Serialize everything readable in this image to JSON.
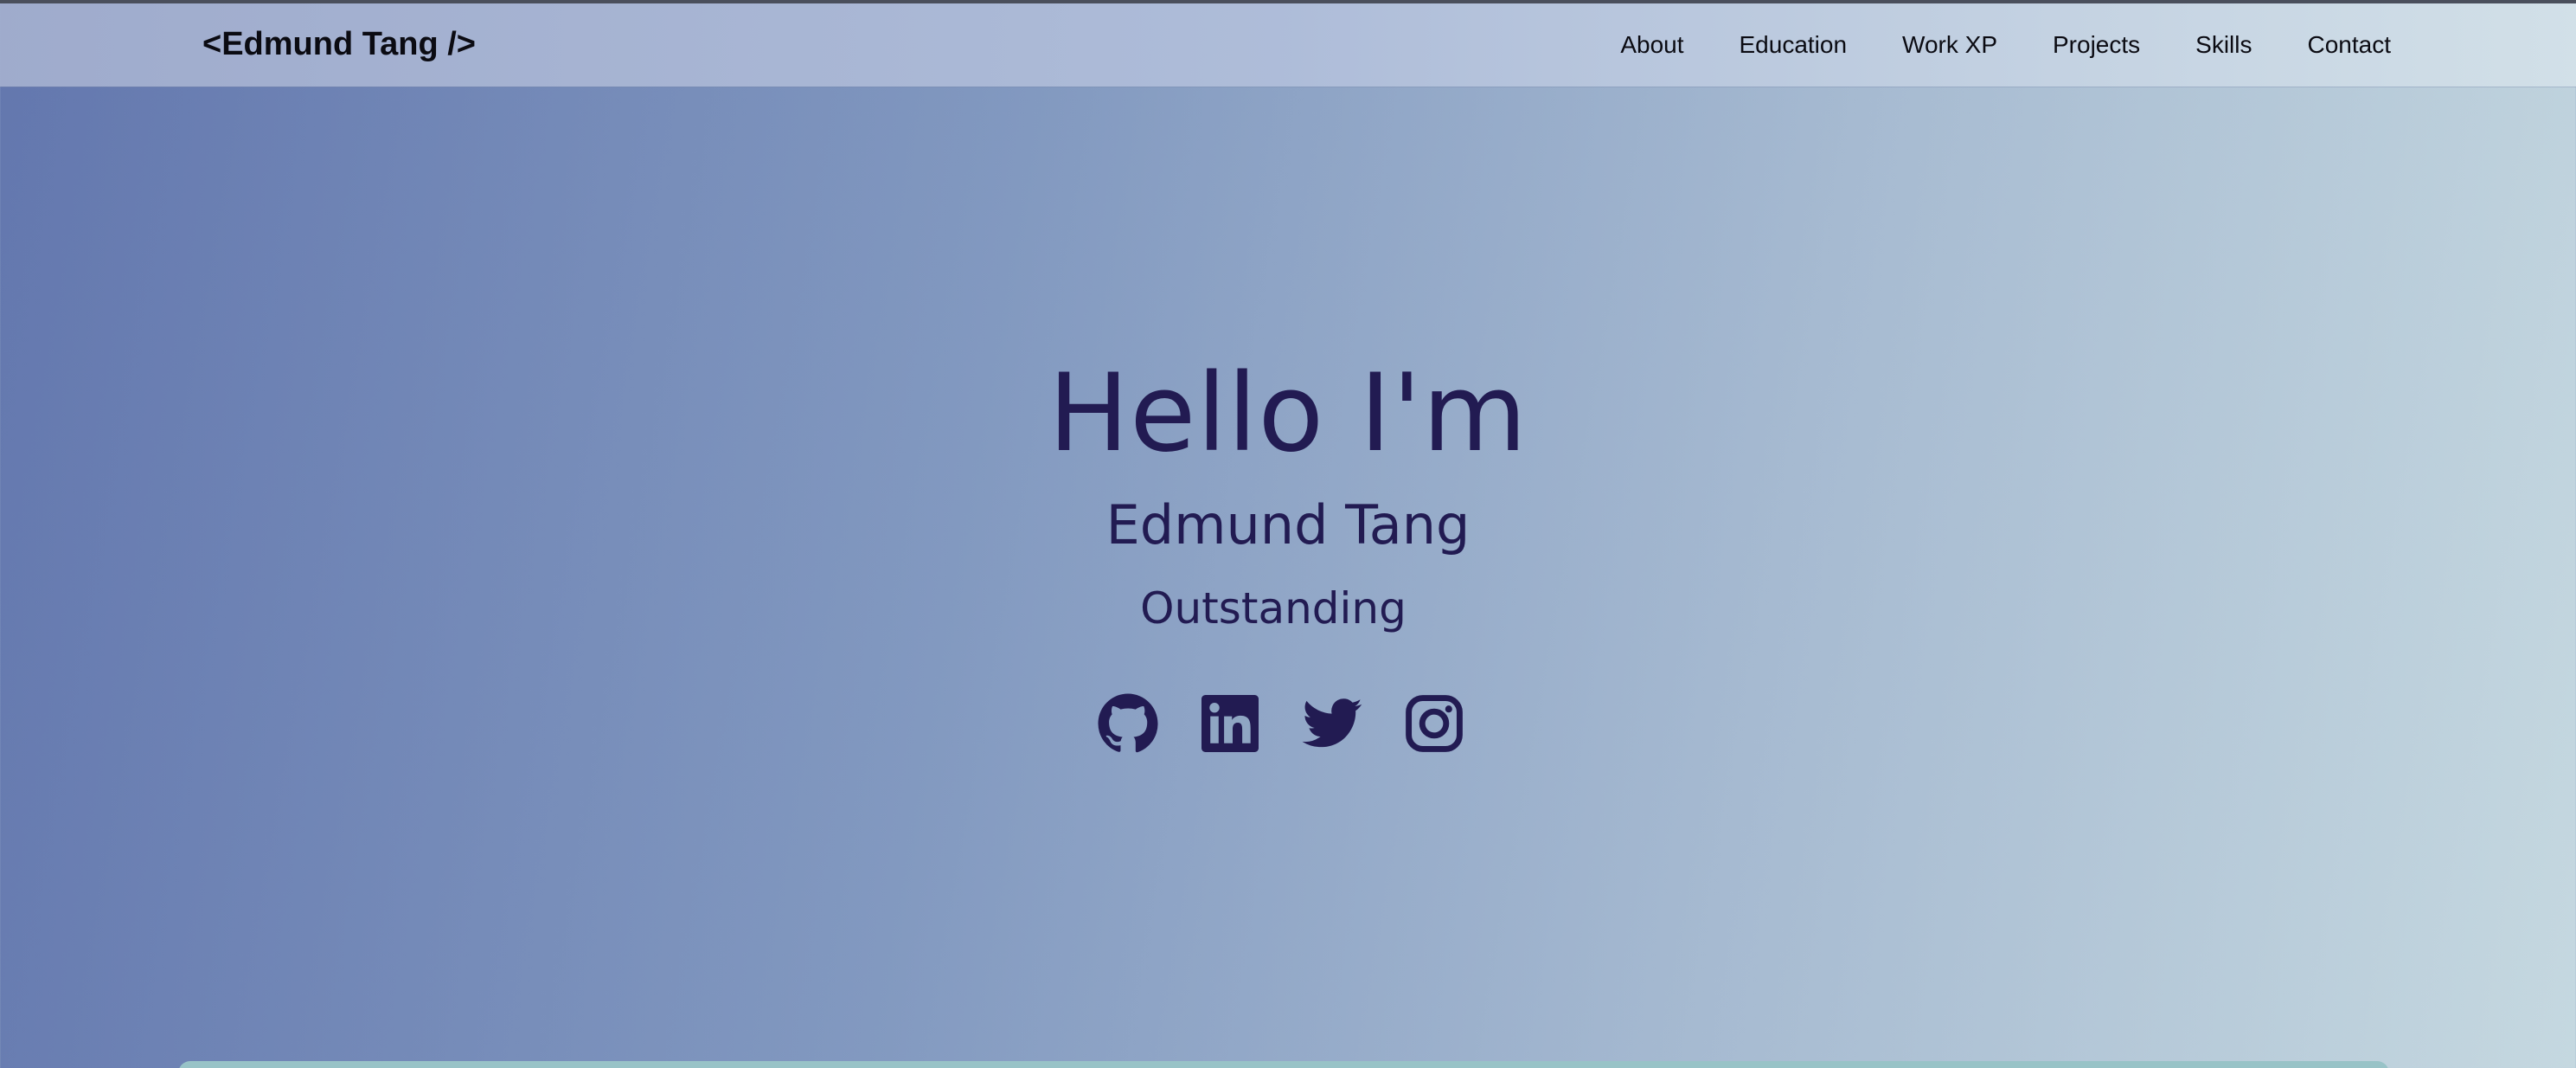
{
  "navbar": {
    "brand": "<Edmund Tang />",
    "links": [
      "About",
      "Education",
      "Work XP",
      "Projects",
      "Skills",
      "Contact"
    ]
  },
  "hero": {
    "greeting": "Hello I'm",
    "name": "Edmund Tang",
    "tagline": "Outstanding",
    "socials": [
      "github-icon",
      "linkedin-icon",
      "twitter-icon",
      "instagram-icon"
    ]
  },
  "colors": {
    "text_dark": "#221b52",
    "nav_text": "#0b0b12",
    "gradient_start": "#6377ae",
    "gradient_end": "#c5d8e0",
    "card_accent": "#98c3c7"
  }
}
